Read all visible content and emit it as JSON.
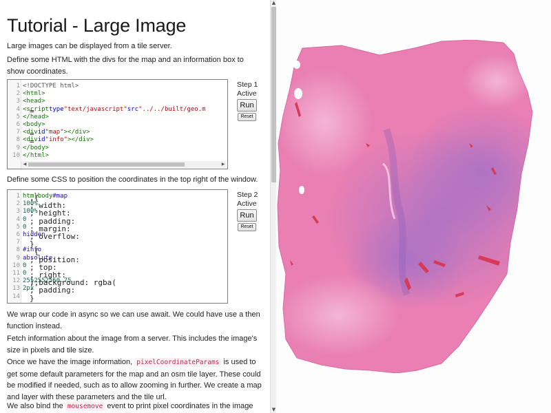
{
  "tutorial": {
    "title": "Tutorial - Large Image",
    "intro": "Large images can be displayed from a tile server.",
    "step1_desc": "Define some HTML with the divs for the map and an information box to show coordinates.",
    "step2_desc": "Define some CSS to position the coordinates in the top right of the window.",
    "para_async": "We wrap our code in async so we can use await. We could have use a then function instead.",
    "para_fetch": "Fetch information about the image from a server. This includes the image's size in pixels and tile size.",
    "para_params_before": "Once we have the image information,",
    "para_params_code": "pixelCoordinateParams",
    "para_params_after": "is used to get some default parameters for the map and an osm tile layer. These could be modified if needed, such as to allow zooming in further. We create a map and layer with these parameters and the tile url.",
    "para_bind_before": "We also bind the",
    "para_bind_code": "mousemove",
    "para_bind_after": "event to print pixel coordinates in the image space."
  },
  "steps": [
    {
      "label": "Step 1",
      "status": "Active",
      "run_label": "Run",
      "reset_label": "Reset"
    },
    {
      "label": "Step 2",
      "status": "Active",
      "run_label": "Run",
      "reset_label": "Reset"
    }
  ],
  "code_step1": [
    {
      "n": "1",
      "tokens": [
        [
          "d",
          "<!DOCTYPE html>"
        ]
      ]
    },
    {
      "n": "2",
      "tokens": [
        [
          "t",
          "<html>"
        ]
      ]
    },
    {
      "n": "3",
      "tokens": [
        [
          "t",
          "<head>"
        ]
      ]
    },
    {
      "n": "4",
      "tokens": [
        [
          "p",
          "  "
        ],
        [
          "t",
          "<script"
        ],
        [
          "p",
          " "
        ],
        [
          "a",
          "type"
        ],
        [
          "p",
          "="
        ],
        [
          "s",
          "\"text/javascript\""
        ],
        [
          "p",
          " "
        ],
        [
          "a",
          "src"
        ],
        [
          "p",
          "="
        ],
        [
          "s",
          "\"../../built/geo.m"
        ]
      ]
    },
    {
      "n": "5",
      "tokens": [
        [
          "t",
          "</head>"
        ]
      ]
    },
    {
      "n": "6",
      "tokens": [
        [
          "t",
          "<body>"
        ]
      ]
    },
    {
      "n": "7",
      "tokens": [
        [
          "p",
          "  "
        ],
        [
          "t",
          "<div"
        ],
        [
          "p",
          " "
        ],
        [
          "a",
          "id"
        ],
        [
          "p",
          "="
        ],
        [
          "s",
          "\"map\""
        ],
        [
          "t",
          "></div>"
        ]
      ]
    },
    {
      "n": "8",
      "tokens": [
        [
          "p",
          "  "
        ],
        [
          "t",
          "<div"
        ],
        [
          "p",
          " "
        ],
        [
          "a",
          "id"
        ],
        [
          "p",
          "="
        ],
        [
          "s",
          "\"info\""
        ],
        [
          "t",
          "></div>"
        ]
      ]
    },
    {
      "n": "9",
      "tokens": [
        [
          "t",
          "</body>"
        ]
      ]
    },
    {
      "n": "10",
      "tokens": [
        [
          "t",
          "</html>"
        ]
      ]
    }
  ],
  "code_step2": [
    {
      "n": "1",
      "tokens": [
        [
          "t",
          "html"
        ],
        [
          "p",
          ","
        ],
        [
          "t",
          "body"
        ],
        [
          "p",
          ","
        ],
        [
          "k",
          "#map"
        ],
        [
          "p",
          " {"
        ]
      ]
    },
    {
      "n": "2",
      "tokens": [
        [
          "p",
          "  width: "
        ],
        [
          "n",
          "100%"
        ],
        [
          "p",
          ";"
        ]
      ]
    },
    {
      "n": "3",
      "tokens": [
        [
          "p",
          "  height: "
        ],
        [
          "n",
          "100%"
        ],
        [
          "p",
          ";"
        ]
      ]
    },
    {
      "n": "4",
      "tokens": [
        [
          "p",
          "  padding: "
        ],
        [
          "n",
          "0"
        ],
        [
          "p",
          ";"
        ]
      ]
    },
    {
      "n": "5",
      "tokens": [
        [
          "p",
          "  margin: "
        ],
        [
          "n",
          "0"
        ],
        [
          "p",
          ";"
        ]
      ]
    },
    {
      "n": "6",
      "tokens": [
        [
          "p",
          "  overflow: "
        ],
        [
          "k",
          "hidden"
        ],
        [
          "p",
          ";"
        ]
      ]
    },
    {
      "n": "7",
      "tokens": [
        [
          "p",
          "}"
        ]
      ]
    },
    {
      "n": "8",
      "tokens": [
        [
          "k",
          "#info"
        ],
        [
          "p",
          " {"
        ]
      ]
    },
    {
      "n": "9",
      "tokens": [
        [
          "p",
          "  position: "
        ],
        [
          "k",
          "absolute"
        ],
        [
          "p",
          ";"
        ]
      ]
    },
    {
      "n": "10",
      "tokens": [
        [
          "p",
          "  top: "
        ],
        [
          "n",
          "0"
        ],
        [
          "p",
          ";"
        ]
      ]
    },
    {
      "n": "11",
      "tokens": [
        [
          "p",
          "  right: "
        ],
        [
          "n",
          "0"
        ],
        [
          "p",
          ";"
        ]
      ]
    },
    {
      "n": "12",
      "tokens": [
        [
          "p",
          "  background: rgba("
        ],
        [
          "n",
          "255"
        ],
        [
          "p",
          ","
        ],
        [
          "n",
          "255"
        ],
        [
          "p",
          ","
        ],
        [
          "n",
          "255"
        ],
        [
          "p",
          ","
        ],
        [
          "n",
          "0.75"
        ],
        [
          "p",
          ");"
        ]
      ]
    },
    {
      "n": "13",
      "tokens": [
        [
          "p",
          "  padding: "
        ],
        [
          "n",
          "2px"
        ],
        [
          "p",
          ";"
        ]
      ]
    },
    {
      "n": "14",
      "tokens": [
        [
          "p",
          "}"
        ]
      ]
    }
  ],
  "colors": {
    "tissue_pink": "#e97fb3",
    "tissue_purple": "#a070c8",
    "blood_red": "#d63a57"
  },
  "icons": {
    "scroll_up": "▲",
    "scroll_down": "▼",
    "scroll_left": "◀",
    "scroll_right": "▶"
  }
}
